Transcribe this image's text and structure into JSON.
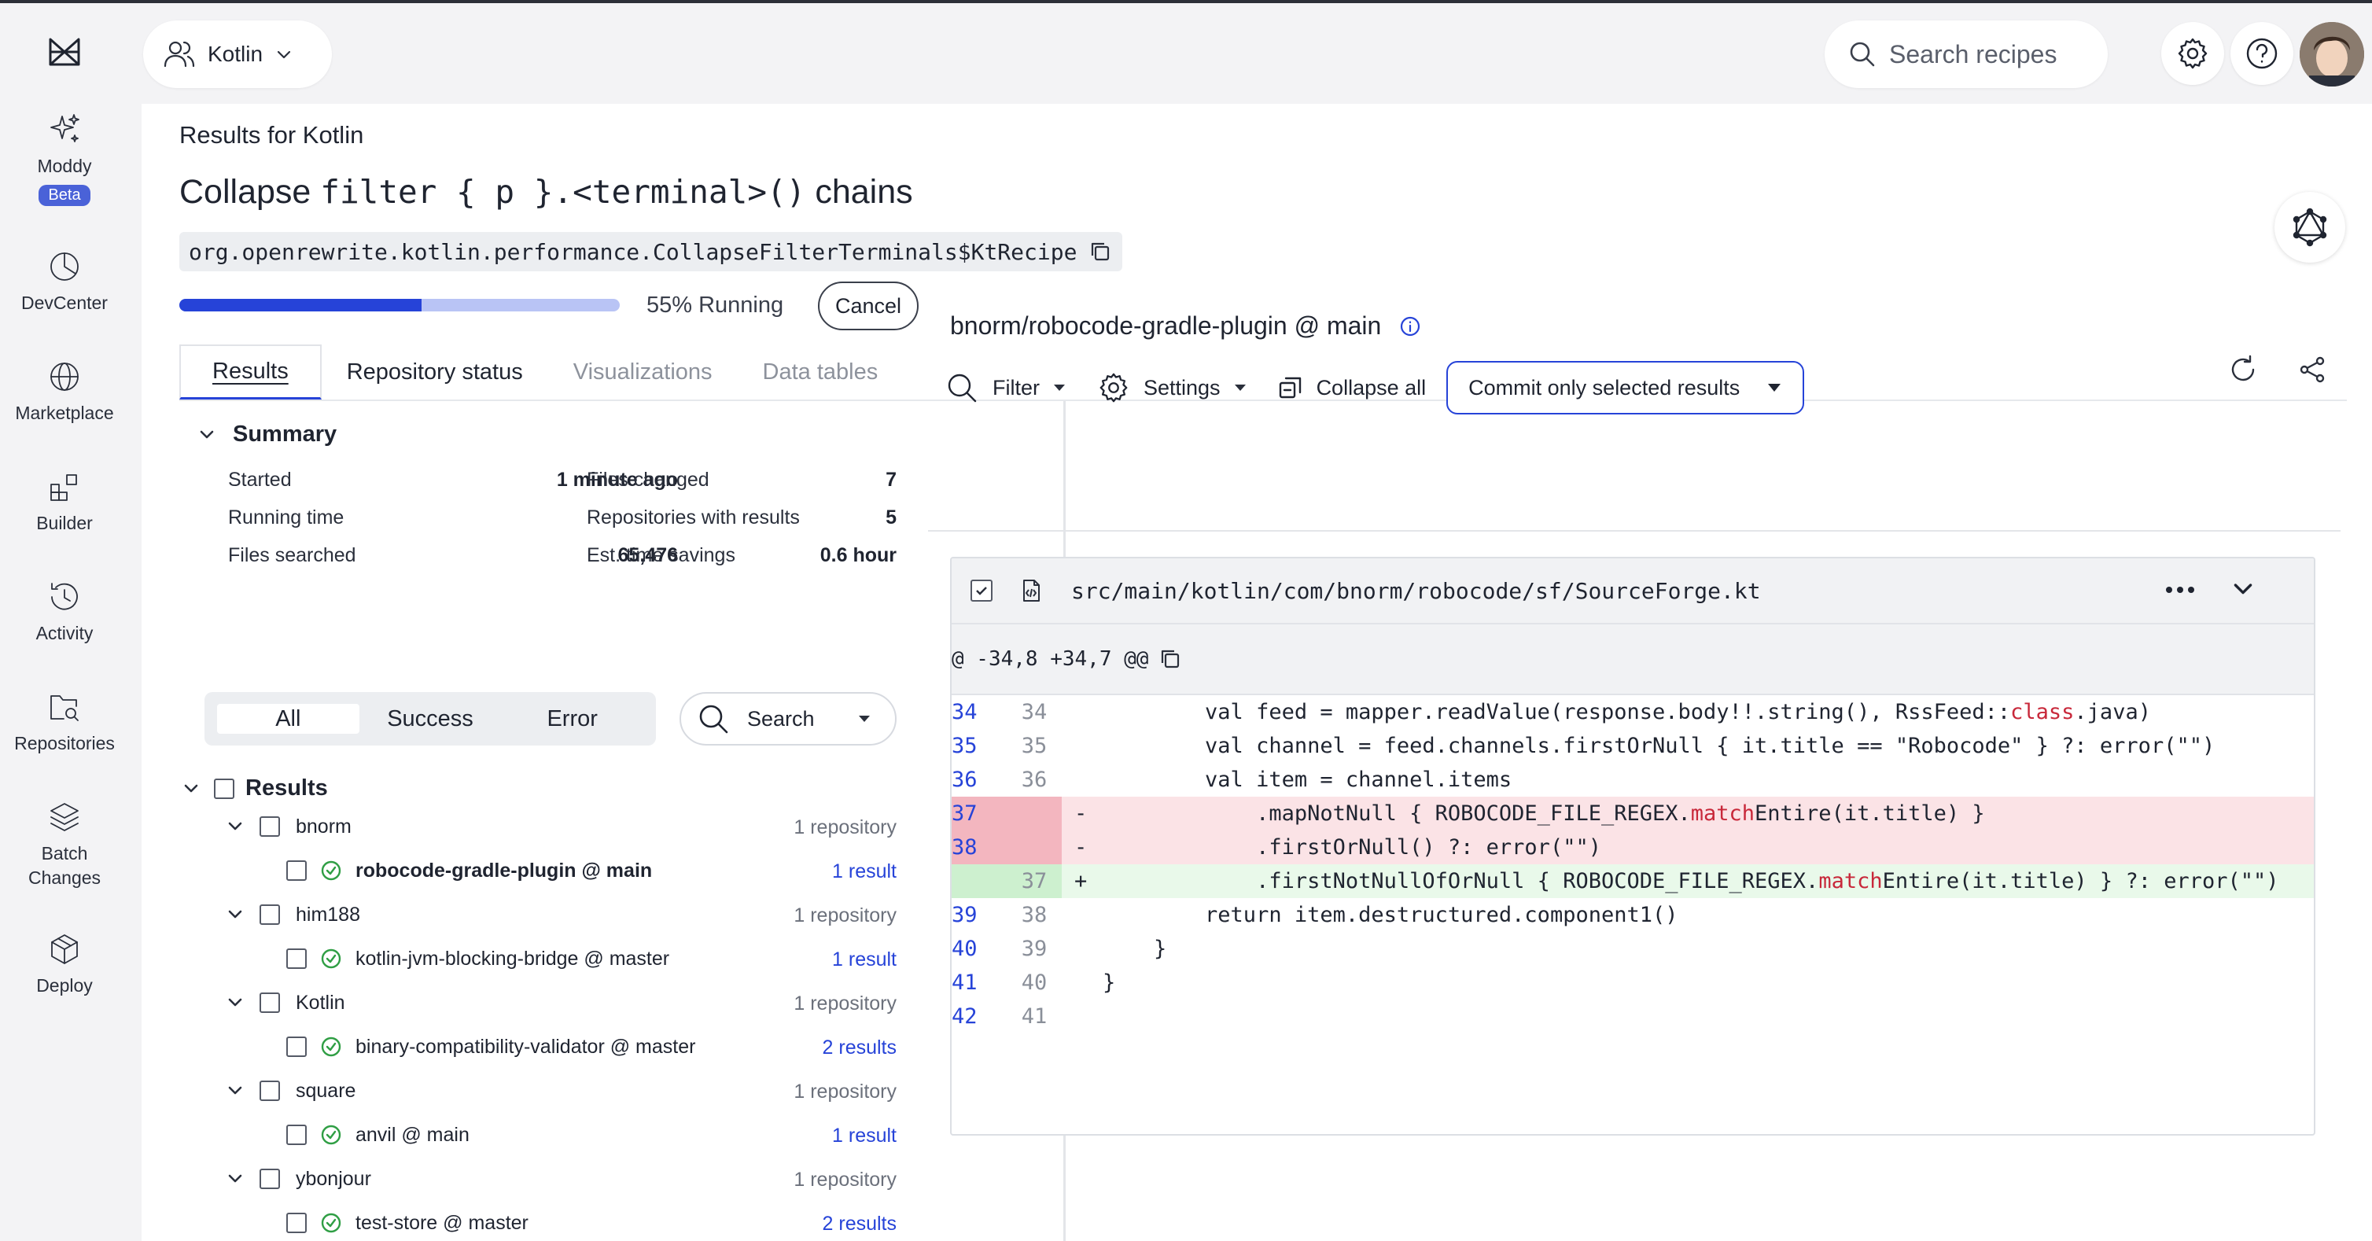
{
  "sidebar": {
    "items": [
      {
        "label": "Moddy",
        "badge": "Beta"
      },
      {
        "label": "DevCenter"
      },
      {
        "label": "Marketplace"
      },
      {
        "label": "Builder"
      },
      {
        "label": "Activity"
      },
      {
        "label": "Repositories"
      },
      {
        "label": "Batch\nChanges"
      },
      {
        "label": "Deploy"
      }
    ]
  },
  "header": {
    "workspace": "Kotlin",
    "search_placeholder": "Search recipes"
  },
  "page": {
    "results_for": "Results for Kotlin",
    "title_prefix": "Collapse ",
    "title_code": "filter { p }.<terminal>()",
    "title_suffix": " chains",
    "recipe_id": "org.openrewrite.kotlin.performance.CollapseFilterTerminals$KtRecipe",
    "progress_percent": 55,
    "progress_secondary_percent": 100,
    "progress_text": "55% Running",
    "cancel_label": "Cancel"
  },
  "tabs": [
    {
      "label": "Results",
      "active": true
    },
    {
      "label": "Repository status"
    },
    {
      "label": "Visualizations",
      "disabled": true
    },
    {
      "label": "Data tables",
      "disabled": true
    }
  ],
  "summary": {
    "heading": "Summary",
    "rows": [
      {
        "label": "Started",
        "value": "1 minute ago"
      },
      {
        "label": "Running time",
        "value": ""
      },
      {
        "label": "Files searched",
        "value": "65,476"
      },
      {
        "label": "Files changed",
        "value": "7"
      },
      {
        "label": "Repositories with results",
        "value": "5"
      },
      {
        "label": "Est. time savings",
        "value": "0.6 hour"
      }
    ]
  },
  "filters": {
    "options": [
      "All",
      "Success",
      "Error"
    ],
    "selected": "All",
    "search_label": "Search"
  },
  "results_tree": {
    "heading": "Results",
    "orgs": [
      {
        "name": "bnorm",
        "meta": "1 repository",
        "repo": "robocode-gradle-plugin @ main",
        "results": "1 result",
        "selected": true
      },
      {
        "name": "him188",
        "meta": "1 repository",
        "repo": "kotlin-jvm-blocking-bridge @ master",
        "results": "1 result"
      },
      {
        "name": "Kotlin",
        "meta": "1 repository",
        "repo": "binary-compatibility-validator @ master",
        "results": "2 results"
      },
      {
        "name": "square",
        "meta": "1 repository",
        "repo": "anvil @ main",
        "results": "1 result"
      },
      {
        "name": "ybonjour",
        "meta": "1 repository",
        "repo": "test-store @ master",
        "results": "2 results"
      }
    ]
  },
  "detail": {
    "repo_title": "bnorm/robocode-gradle-plugin @ main",
    "toolbar": {
      "filter": "Filter",
      "settings": "Settings",
      "collapse": "Collapse all",
      "commit": "Commit only selected results"
    },
    "file_path": "src/main/kotlin/com/bnorm/robocode/sf/SourceForge.kt",
    "hunk_header": "@ -34,8 +34,7 @@",
    "lines": [
      {
        "old": "34",
        "new": "34",
        "type": "ctx",
        "code": "        val feed = mapper.readValue(response.body!!.string(), RssFeed::class.java)"
      },
      {
        "old": "35",
        "new": "35",
        "type": "ctx",
        "code": "        val channel = feed.channels.firstOrNull { it.title == \"Robocode\" } ?: error(\"\")"
      },
      {
        "old": "36",
        "new": "36",
        "type": "ctx",
        "code": "        val item = channel.items"
      },
      {
        "old": "37",
        "new": "",
        "type": "del",
        "code": "            .mapNotNull { ROBOCODE_FILE_REGEX.matchEntire(it.title) }"
      },
      {
        "old": "38",
        "new": "",
        "type": "del",
        "code": "            .firstOrNull() ?: error(\"\")"
      },
      {
        "old": "",
        "new": "37",
        "type": "add",
        "code": "            .firstNotNullOfOrNull { ROBOCODE_FILE_REGEX.matchEntire(it.title) } ?: error(\"\")"
      },
      {
        "old": "39",
        "new": "38",
        "type": "ctx",
        "code": "        return item.destructured.component1()"
      },
      {
        "old": "40",
        "new": "39",
        "type": "ctx",
        "code": "    }"
      },
      {
        "old": "41",
        "new": "40",
        "type": "ctx",
        "code": "}"
      },
      {
        "old": "42",
        "new": "41",
        "type": "ctx",
        "code": ""
      }
    ]
  },
  "colors": {
    "accent": "#2643d8",
    "success": "#2f9e44",
    "deleted_bg": "#fbe3e6",
    "added_bg": "#e9f9ea"
  }
}
